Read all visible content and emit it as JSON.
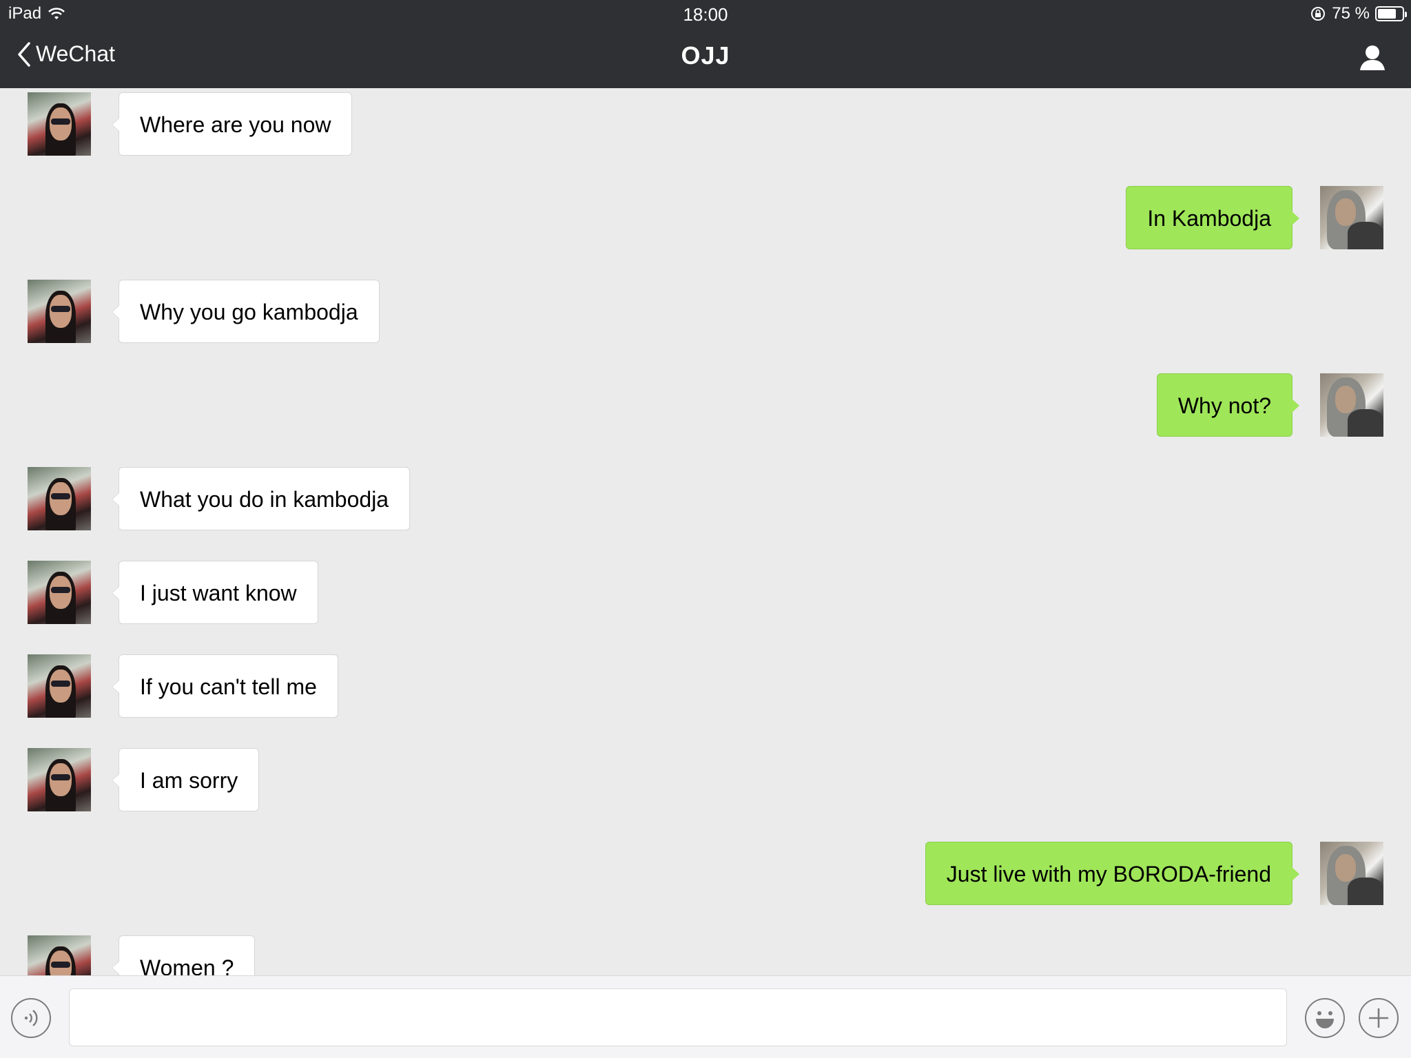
{
  "status_bar": {
    "device": "iPad",
    "time": "18:00",
    "battery": "75 %",
    "battery_level": 0.75
  },
  "nav": {
    "back_label": "WeChat",
    "title": "OJJ"
  },
  "messages": [
    {
      "side": "in",
      "text": "Where are you now"
    },
    {
      "side": "out",
      "text": "In Kambodja"
    },
    {
      "side": "in",
      "text": "Why you go kambodja"
    },
    {
      "side": "out",
      "text": "Why not?"
    },
    {
      "side": "in",
      "text": "What you do in kambodja"
    },
    {
      "side": "in",
      "text": "I just want know"
    },
    {
      "side": "in",
      "text": "If you can't tell me"
    },
    {
      "side": "in",
      "text": "I am sorry"
    },
    {
      "side": "out",
      "text": "Just live with my BORODA-friend"
    },
    {
      "side": "in",
      "text": "Women ?"
    }
  ],
  "input": {
    "value": "",
    "placeholder": ""
  },
  "icons": {
    "back": "chevron-left-icon",
    "profile": "person-icon",
    "voice": "voice-icon",
    "emoji": "emoji-icon",
    "plus": "plus-icon",
    "wifi": "wifi-icon",
    "rotation_lock": "rotation-lock-icon",
    "battery": "battery-icon"
  },
  "colors": {
    "nav_bg": "#2f3033",
    "chat_bg": "#ebebeb",
    "bubble_out": "#9fe659",
    "bubble_in": "#ffffff"
  }
}
